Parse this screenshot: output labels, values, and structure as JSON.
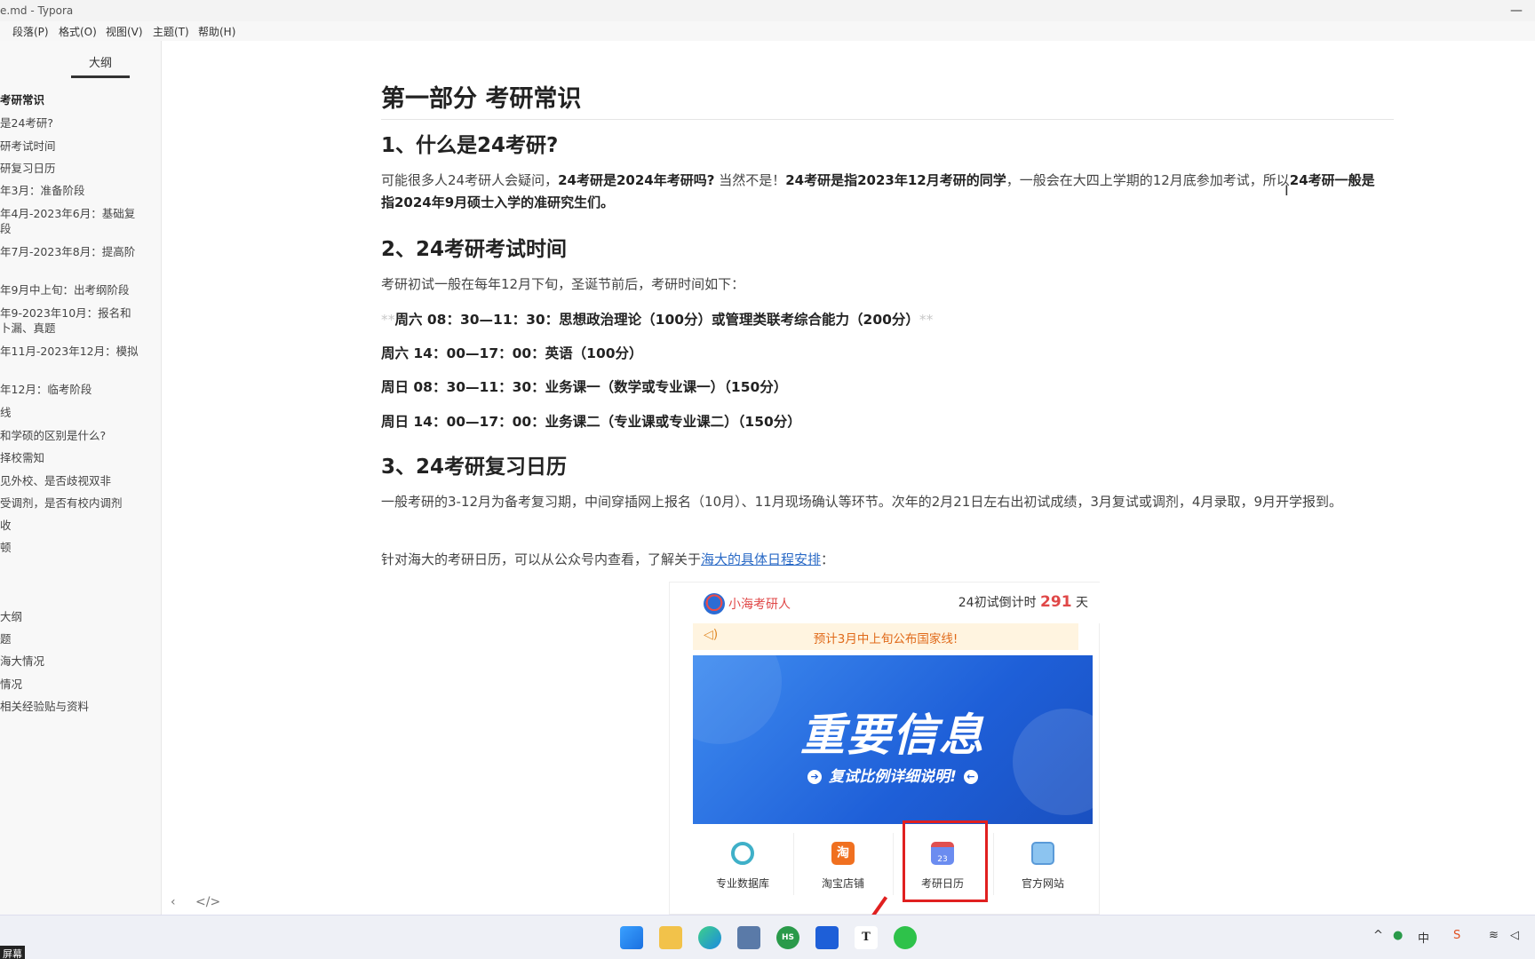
{
  "window": {
    "title": "e.md - Typora"
  },
  "menu": [
    "段落(P)",
    "格式(O)",
    "视图(V)",
    "主题(T)",
    "帮助(H)"
  ],
  "sidebar": {
    "tab": "大纲",
    "items": [
      "考研常识",
      "是24考研?",
      "研考试时间",
      "研复习日历",
      "年3月：准备阶段",
      "年4月-2023年6月：基础复\n段",
      "年7月-2023年8月：提高阶",
      "年9月中上旬：出考纲阶段",
      "年9-2023年10月：报名和\n卜漏、真题",
      "年11月-2023年12月：模拟",
      "年12月：临考阶段",
      "线",
      "和学硕的区别是什么?",
      "择校需知",
      "见外校、是否歧视双非",
      "受调剂，是否有校内调剂",
      "收",
      "顿",
      "大纲",
      "题",
      "海大情况",
      "情况",
      "相关经验贴与资料"
    ]
  },
  "doc": {
    "h1": "第一部分 考研常识",
    "s1": {
      "title": "1、什么是24考研?",
      "p_a": "可能很多人24考研人会疑问，",
      "p_b": "24考研是2024年考研吗?",
      "p_c": " 当然不是！",
      "p_d": "24考研是指2023年12月考研的同学",
      "p_e": "，一般会在大四上学期的12月底参加考试，所以",
      "p_f": "24考研一般是指2024年9月硕士入学的准研究生们。"
    },
    "s2": {
      "title": "2、24考研考试时间",
      "intro": "考研初试一般在每年12月下旬，圣诞节前后，考研时间如下：",
      "md_mark": "**",
      "sched1": "周六 08：30—11：30：思想政治理论（100分）或管理类联考综合能力（200分）",
      "sched2": "周六 14：00—17：00：英语（100分）",
      "sched3": "周日 08：30—11：30：业务课一（数学或专业课一）（150分）",
      "sched4": "周日 14：00—17：00：业务课二（专业课或专业课二）（150分）"
    },
    "s3": {
      "title": "3、24考研复习日历",
      "p1": "一般考研的3-12月为备考复习期，中间穿插网上报名（10月）、11月现场确认等环节。次年的2月21日左右出初试成绩，3月复试或调剂，4月录取，9月开学报到。",
      "p2_pre": "针对海大的考研日历，可以从公众号内查看，了解关于",
      "p2_link": "海大的具体日程安排",
      "p2_post": "："
    }
  },
  "embedded": {
    "app_name": "小海考研人",
    "countdown_pre": "24初试倒计时",
    "countdown_num": "291",
    "countdown_post": "天",
    "notice": "预计3月中上旬公布国家线!",
    "banner_title": "重要信息",
    "banner_sub": "复试比例详细说明!",
    "shortcuts": [
      "专业数据库",
      "淘宝店铺",
      "考研日历",
      "官方网站"
    ],
    "shortcut_glyphs": [
      "",
      "淘",
      "23",
      ""
    ]
  },
  "taskbar": {
    "corner": "屏幕",
    "apps": [
      "start",
      "file-explorer",
      "edge",
      "remote",
      "hs",
      "mail",
      "typora",
      "wechat"
    ],
    "typora_glyph": "T",
    "hs_glyph": "HS",
    "ime": "中"
  },
  "colors": {
    "accent": "#2a6ac6",
    "highlight": "#e02020",
    "countdown": "#e04848"
  }
}
